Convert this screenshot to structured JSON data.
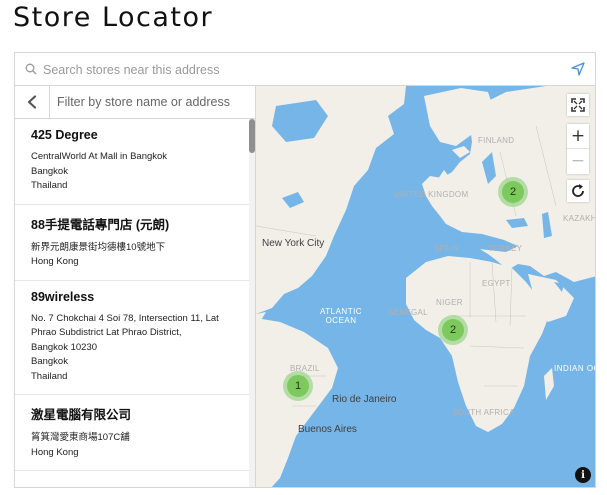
{
  "page": {
    "title": "Store Locator"
  },
  "search": {
    "placeholder": "Search stores near this address",
    "value": ""
  },
  "sidebar": {
    "filter_placeholder": "Filter by store name or address",
    "stores": [
      {
        "name": "425 Degree",
        "lines": [
          "CentralWorld At Mall in Bangkok",
          "Bangkok",
          "Thailand"
        ]
      },
      {
        "name": "88手提電話專門店 (元朗)",
        "lines": [
          "新界元朗康景街均德樓10號地下",
          "Hong Kong"
        ]
      },
      {
        "name": "89wireless",
        "lines": [
          "No. 7 Chokchai 4 Soi 78, Intersection 11, Lat",
          "Phrao Subdistrict Lat Phrao District,",
          "Bangkok 10230",
          "Bangkok",
          "Thailand"
        ]
      },
      {
        "name": "激星電腦有限公司",
        "lines": [
          "筲箕灣愛東商場107C舖",
          "Hong Kong"
        ]
      }
    ]
  },
  "map": {
    "colors": {
      "water": "#76b5e7",
      "land": "#f2efe9",
      "cluster": "#7dc95e"
    },
    "clusters": [
      {
        "count": "2",
        "region": "eastern-europe"
      },
      {
        "count": "2",
        "region": "west-africa"
      },
      {
        "count": "1",
        "region": "south-america"
      }
    ],
    "labels": {
      "new_york": "New York City",
      "atlantic": "ATLANTIC",
      "ocean": "OCEAN",
      "rio": "Rio de Janeiro",
      "buenos_aires": "Buenos Aires",
      "indian_ocean": "INDIAN OC",
      "brazil": "BRAZIL",
      "south_africa": "SOUTH AFRICA",
      "kazakh": "KAZAKH",
      "egypt": "EGYPT",
      "niger": "NIGER",
      "senegal": "SENEGAL",
      "turkey": "TURKEY",
      "spain": "SPAIN",
      "finland": "FINLAND",
      "united_kingdom": "UNITED KINGDOM"
    },
    "controls": {
      "zoom_in": "+",
      "zoom_out": "−",
      "info": "i"
    }
  }
}
